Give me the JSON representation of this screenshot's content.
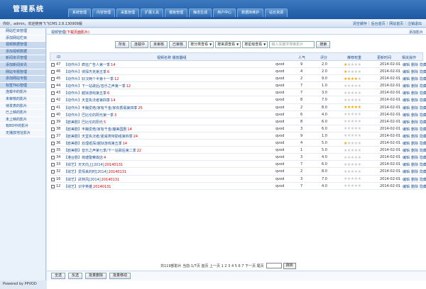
{
  "app": {
    "title": "管理系统"
  },
  "nav": {
    "tabs": [
      "系统管理",
      "内容管理",
      "采集管理",
      "扩展工具",
      "模板管理",
      "静态生成",
      "用户中心",
      "数据库维护",
      "站长资源"
    ]
  },
  "header": {
    "welcome": "你好，admin，欢迎使用飞飞CMS 2.8.130909版"
  },
  "quick_links": [
    "清空缓存",
    "后台首页",
    "网站首页",
    "注销退出"
  ],
  "sidebar": {
    "items": [
      {
        "label": "网站栏目管理",
        "style": "light"
      },
      {
        "label": "添加网站栏目",
        "style": "light"
      },
      {
        "label": "视频数据管理",
        "style": "dark"
      },
      {
        "label": "添加视频数据",
        "style": "dark"
      },
      {
        "label": "新闻资讯管理",
        "style": "dark"
      },
      {
        "label": "添加新闻资讯",
        "style": "dark"
      },
      {
        "label": "网站专题管理",
        "style": "dark"
      },
      {
        "label": "添加网站专题",
        "style": "dark"
      },
      {
        "label": "标签TAG管理",
        "style": "dark"
      },
      {
        "label": "连载中的影片",
        "style": "light"
      },
      {
        "label": "未审核的影片",
        "style": "light"
      },
      {
        "label": "待发表的影片",
        "style": "light"
      },
      {
        "label": "已上映的影片",
        "style": "light"
      },
      {
        "label": "未上映的影片",
        "style": "light"
      },
      {
        "label": "有BD中的影片",
        "style": "light"
      },
      {
        "label": "无播放地址影片",
        "style": "light"
      }
    ],
    "powered": "Powered by PPVOD"
  },
  "breadcrumb": {
    "prefix": "视频管理",
    "highlight": "(下载页面影片)"
  },
  "add_link": "添加影片",
  "filter": {
    "buttons": [
      "所有",
      "连载中",
      "未审核",
      "已审核"
    ],
    "selects": [
      "按分类查看",
      "按来源查看",
      "按星级查看"
    ],
    "search_placeholder": "输入关键字搜索影片",
    "search_button": "搜索"
  },
  "table": {
    "columns": {
      "id": "ID",
      "title": "视频名称  播放器组",
      "play": "",
      "hits": "人气",
      "score": "评分",
      "stars": "推荐权重",
      "date": "更新时间",
      "ops": "相关操作"
    },
    "row_ops": [
      "编辑",
      "删除",
      "隐藏"
    ],
    "rows": [
      {
        "id": "47",
        "tag": "【动作片】",
        "title": "疯狂广告人第一季",
        "num": "14",
        "play": "qvod",
        "hits": "9",
        "score": "2.0",
        "stars": 1,
        "date": "2014-02-01"
      },
      {
        "id": "46",
        "tag": "【动作片】",
        "title": "侠探杰克第五季",
        "num": "6",
        "play": "qvod",
        "hits": "4",
        "score": "2.0",
        "stars": 1,
        "date": "2014-02-01"
      },
      {
        "id": "45",
        "tag": "【动作片】",
        "title": "好汉两个半第十一季",
        "num": "12",
        "play": "qvod",
        "hits": "2",
        "score": "9.0",
        "stars": 4,
        "date": "2014-02-01"
      },
      {
        "id": "44",
        "tag": "【动作片】",
        "title": "下一站歌后/音乐之声第一季",
        "num": "12",
        "play": "qvod",
        "hits": "7",
        "score": "1.0",
        "stars": 0,
        "date": "2014-02-01"
      },
      {
        "id": "43",
        "tag": "【动作片】",
        "title": "越狱游戏第五季",
        "num": "6",
        "play": "qvod",
        "hits": "7",
        "score": "3.0",
        "stars": 0,
        "date": "2014-02-01"
      },
      {
        "id": "42",
        "tag": "【动作片】",
        "title": "天堂执法者第四季",
        "num": "14",
        "play": "qvod",
        "hits": "8",
        "score": "7.0",
        "stars": 0,
        "date": "2014-02-01"
      },
      {
        "id": "41",
        "tag": "【动作片】",
        "title": "丰胸爱皓/家有千金/家有香假第四季",
        "num": "25",
        "play": "qvod",
        "hits": "2",
        "score": "8.0",
        "stars": 5,
        "date": "2014-02-01"
      },
      {
        "id": "40",
        "tag": "【动作片】",
        "title": "巴比伦的阳光第一季",
        "num": "3",
        "play": "qvod",
        "hits": "6",
        "score": "4.0",
        "stars": 0,
        "date": "2014-02-01"
      },
      {
        "id": "39",
        "tag": "【欧美剧】",
        "title": "巴比伦的阳光",
        "num": "5",
        "play": "qvod",
        "hits": "8",
        "score": "6.0",
        "stars": 0,
        "date": "2014-02-01"
      },
      {
        "id": "38",
        "tag": "【欧美剧】",
        "title": "丰胸爱皓/家有千金/魔美国剧",
        "num": "14",
        "play": "qvod",
        "hits": "3",
        "score": "6.0",
        "stars": 0,
        "date": "2014-02-01"
      },
      {
        "id": "37",
        "tag": "【欧美剧】",
        "title": "天堂执法者/夏威夷特勤组第四季",
        "num": "24",
        "play": "qvod",
        "hits": "9",
        "score": "1.0",
        "stars": 0,
        "date": "2014-02-01"
      },
      {
        "id": "36",
        "tag": "【欧美剧】",
        "title": "处理纸探/越狱游戏第五季",
        "num": "14",
        "play": "qvod",
        "hits": "4",
        "score": "5.0",
        "stars": 1,
        "date": "2014-02-01"
      },
      {
        "id": "35",
        "tag": "【欧美剧】",
        "title": "音乐之声第七季/下一站歌后第二季",
        "num": "22",
        "play": "qvod",
        "hits": "1",
        "score": "5.0",
        "stars": 0,
        "date": "2014-02-01"
      },
      {
        "id": "34",
        "tag": "【港台剧】",
        "title": "荷塘警察故店",
        "num": "4",
        "play": "qvod",
        "hits": "3",
        "score": "4.0",
        "stars": 0,
        "date": "2014-02-01"
      },
      {
        "id": "33",
        "tag": "【综艺】",
        "title": "天天向上[2014]",
        "num": "20140131",
        "play": "qvod",
        "hits": "7",
        "score": "6.0",
        "stars": 0,
        "date": "2014-02-01"
      },
      {
        "id": "32",
        "tag": "【综艺】",
        "title": "爱情来的时[2014]",
        "num": "20140131",
        "play": "qvod",
        "hits": "2",
        "score": "8.0",
        "stars": 0,
        "date": "2014-02-01"
      },
      {
        "id": "16",
        "tag": "【综艺】",
        "title": "武林风[2014]",
        "num": "20140131",
        "play": "qvod",
        "hits": "3",
        "score": "7.0",
        "stars": 0,
        "date": "2014-02-01"
      },
      {
        "id": "12",
        "tag": "【综艺】",
        "title": "识字英雄",
        "num": "20140131",
        "play": "qvod",
        "hits": "7",
        "score": "4.0",
        "stars": 0,
        "date": "2014-02-01"
      }
    ]
  },
  "pager": {
    "text": "共119部影片  当前:1/7页  首页  上一页 1 2 3 4 5 6 7 下一页  尾页",
    "go_label": "跳转"
  },
  "bulk": {
    "buttons": [
      "全选",
      "反选",
      "批量删除",
      "批量移动"
    ]
  },
  "colors": {
    "header": "#1d58a2",
    "accent": "#1b4f93",
    "star": "#f2a800",
    "highlight": "#dd0000"
  }
}
